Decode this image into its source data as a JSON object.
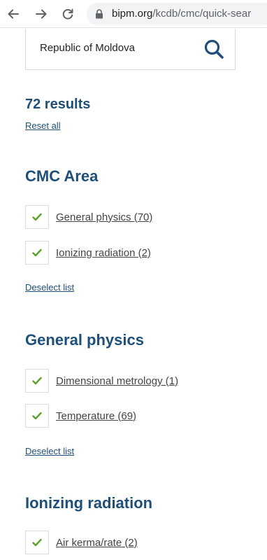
{
  "browser": {
    "url_host": "bipm.org",
    "url_path": "/kcdb/cmc/quick-sear"
  },
  "search": {
    "value": "Republic of Moldova"
  },
  "results": {
    "count_label": "72 results",
    "reset_label": "Reset all"
  },
  "sections": [
    {
      "title": "CMC Area",
      "items": [
        {
          "label": "General physics (70)",
          "checked": true
        },
        {
          "label": "Ionizing radiation (2)",
          "checked": true
        }
      ],
      "deselect_label": "Deselect list"
    },
    {
      "title": "General physics",
      "items": [
        {
          "label": "Dimensional metrology (1)",
          "checked": true
        },
        {
          "label": "Temperature (69)",
          "checked": true
        }
      ],
      "deselect_label": "Deselect list"
    },
    {
      "title": "Ionizing radiation",
      "items": [
        {
          "label": "Air kerma/rate (2)",
          "checked": true
        }
      ]
    }
  ],
  "colors": {
    "heading": "#1e4f7a",
    "check": "#5aa02c"
  }
}
